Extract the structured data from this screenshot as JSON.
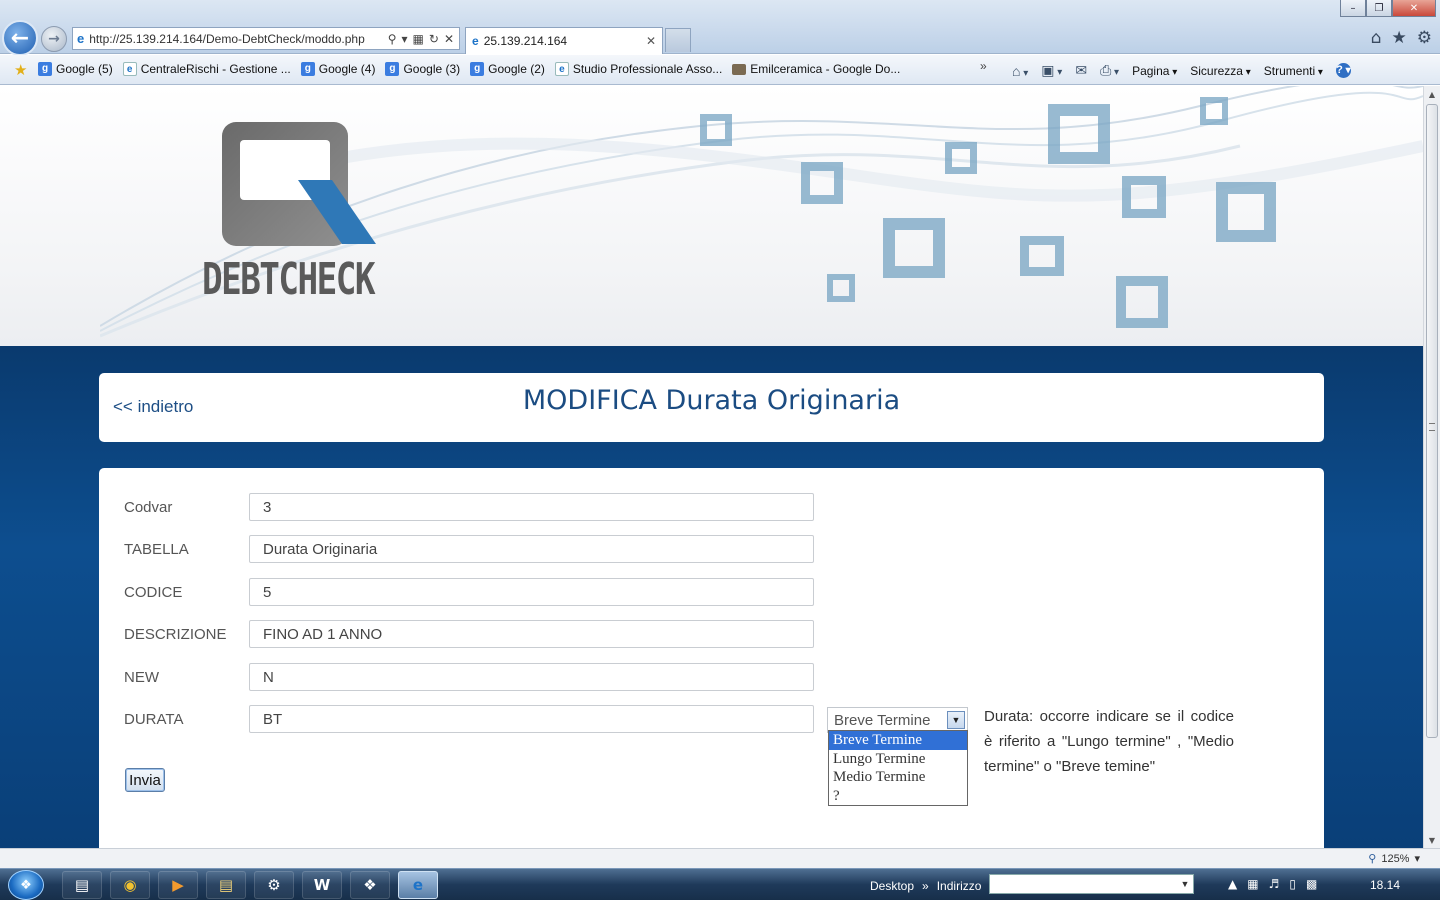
{
  "window": {
    "minimize": "–",
    "restore": "❐",
    "close": "✕"
  },
  "browser": {
    "url": "http://25.139.214.164/Demo-DebtCheck/moddo.php",
    "tab_title": "25.139.214.164",
    "tab_close": "✕",
    "favorites": [
      {
        "label": "Google (5)",
        "icon": "google-icon"
      },
      {
        "label": "CentraleRischi - Gestione ...",
        "icon": "ie-page-icon"
      },
      {
        "label": "Google (4)",
        "icon": "google-icon"
      },
      {
        "label": "Google (3)",
        "icon": "google-icon"
      },
      {
        "label": "Google (2)",
        "icon": "google-icon"
      },
      {
        "label": "Studio Professionale Asso...",
        "icon": "ie-page-icon"
      },
      {
        "label": "Emilceramica - Google Do...",
        "icon": "folder-icon"
      }
    ],
    "favorites_more": "»",
    "commands": {
      "page": "Pagina",
      "safety": "Sicurezza",
      "tools": "Strumenti",
      "help": "?"
    },
    "zoom": "125%"
  },
  "page": {
    "logo_text": "DEBTCHECK",
    "back_link": "<< indietro",
    "title": "MODIFICA Durata Originaria",
    "fields": [
      {
        "label": "Codvar",
        "value": "3"
      },
      {
        "label": "TABELLA",
        "value": "Durata Originaria"
      },
      {
        "label": "CODICE",
        "value": "5"
      },
      {
        "label": "DESCRIZIONE",
        "value": "FINO AD 1 ANNO"
      },
      {
        "label": "NEW",
        "value": "N"
      },
      {
        "label": "DURATA",
        "value": "BT"
      }
    ],
    "submit_label": "Invia",
    "durata_select": {
      "selected": "Breve Termine",
      "options": [
        "Breve Termine",
        "Lungo Termine",
        "Medio Termine",
        "?"
      ]
    },
    "help_text": "Durata: occorre indicare se il codice è riferito a \"Lungo termine\" , \"Medio termine\" o \"Breve temine\""
  },
  "taskbar": {
    "desktop": "Desktop",
    "more": "»",
    "address_label": "Indirizzo",
    "clock": "18.14"
  }
}
